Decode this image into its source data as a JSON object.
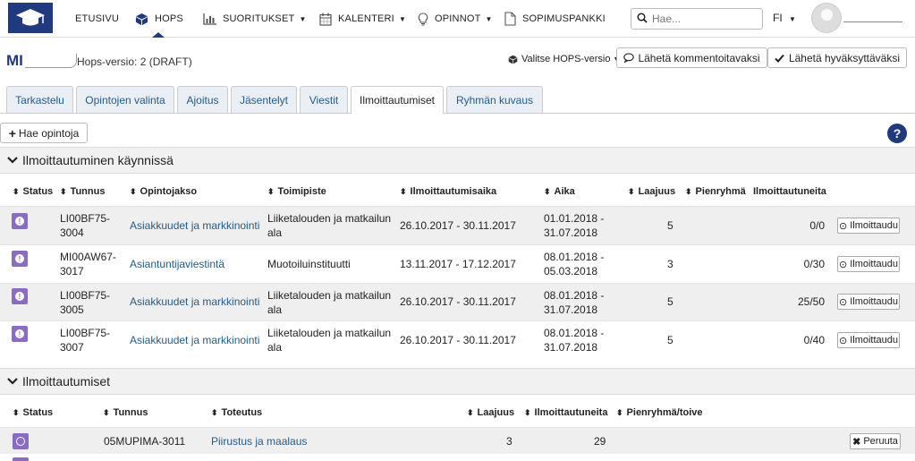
{
  "navbar": {
    "logo_icon": "graduation-cap-icon",
    "brand_color": "#1f3a7e",
    "items": [
      {
        "label": "ETUSIVU",
        "icon": ""
      },
      {
        "label": "HOPS",
        "icon": "cube-icon"
      },
      {
        "label": "SUORITUKSET",
        "icon": "bar-chart-icon"
      },
      {
        "label": "KALENTERI",
        "icon": "calendar-icon"
      },
      {
        "label": "OPINNOT",
        "icon": "lightbulb-icon"
      },
      {
        "label": "SOPIMUSPANKKI",
        "icon": "document-icon"
      }
    ],
    "search_placeholder": "Hae...",
    "language": "FI"
  },
  "header": {
    "student_initials": "MI",
    "hops_version": "Hops-versio: 2 (DRAFT)",
    "select_version": "Valitse HOPS-versio",
    "send_comment": "Lähetä kommentoitavaksi",
    "send_approval": "Lähetä hyväksyttäväksi"
  },
  "tabs": [
    {
      "label": "Tarkastelu"
    },
    {
      "label": "Opintojen valinta"
    },
    {
      "label": "Ajoitus"
    },
    {
      "label": "Jäsentelyt"
    },
    {
      "label": "Viestit"
    },
    {
      "label": "Ilmoittautumiset",
      "active": true
    },
    {
      "label": "Ryhmän kuvaus"
    }
  ],
  "toolbar": {
    "hae_opintoja": "Hae opintoja",
    "help": "?"
  },
  "section1": {
    "title": "Ilmoittautuminen käynnissä",
    "headers": [
      "Status",
      "Tunnus",
      "Opintojakso",
      "Toimipiste",
      "Ilmoittautumisaika",
      "Aika",
      "Laajuus",
      "Pienryhmä",
      "Ilmoittautuneita"
    ],
    "register_label": "Ilmoittaudu",
    "rows": [
      {
        "tunnus1": "LI00BF75-",
        "tunnus2": "3004",
        "opintojakso": "Asiakkuudet ja markkinointi",
        "toimipiste1": "Liiketalouden ja matkailun",
        "toimipiste2": "ala",
        "ilmoaika": "26.10.2017 - 30.11.2017",
        "aika1": "01.01.2018 -",
        "aika2": "31.07.2018",
        "laajuus": "5",
        "ilmoittautuneita": "0/0"
      },
      {
        "tunnus1": "MI00AW67-",
        "tunnus2": "3017",
        "opintojakso": "Asiantuntijaviestintä",
        "toimipiste1": "Muotoiluinstituutti",
        "toimipiste2": "",
        "ilmoaika": "13.11.2017 - 17.12.2017",
        "aika1": "08.01.2018 -",
        "aika2": "05.03.2018",
        "laajuus": "3",
        "ilmoittautuneita": "0/30"
      },
      {
        "tunnus1": "LI00BF75-",
        "tunnus2": "3005",
        "opintojakso": "Asiakkuudet ja markkinointi",
        "toimipiste1": "Liiketalouden ja matkailun",
        "toimipiste2": "ala",
        "ilmoaika": "26.10.2017 - 30.11.2017",
        "aika1": "08.01.2018 -",
        "aika2": "31.07.2018",
        "laajuus": "5",
        "ilmoittautuneita": "25/50"
      },
      {
        "tunnus1": "LI00BF75-",
        "tunnus2": "3007",
        "opintojakso": "Asiakkuudet ja markkinointi",
        "toimipiste1": "Liiketalouden ja matkailun",
        "toimipiste2": "ala",
        "ilmoaika": "26.10.2017 - 30.11.2017",
        "aika1": "08.01.2018 -",
        "aika2": "31.07.2018",
        "laajuus": "5",
        "ilmoittautuneita": "0/40"
      }
    ]
  },
  "section2": {
    "title": "Ilmoittautumiset",
    "headers": [
      "Status",
      "Tunnus",
      "Toteutus",
      "Laajuus",
      "Ilmoittautuneita",
      "Pienryhmä/toive"
    ],
    "cancel_label": "Peruuta",
    "rows": [
      {
        "tunnus": "05MUPIMA-3011",
        "toteutus": "Piirustus ja maalaus",
        "laajuus": "3",
        "ilmoittautuneita": "29",
        "pienryhma": ""
      }
    ]
  },
  "colors": {
    "status_purple": "#8a6bc6",
    "link_blue": "#1f5c8a"
  }
}
